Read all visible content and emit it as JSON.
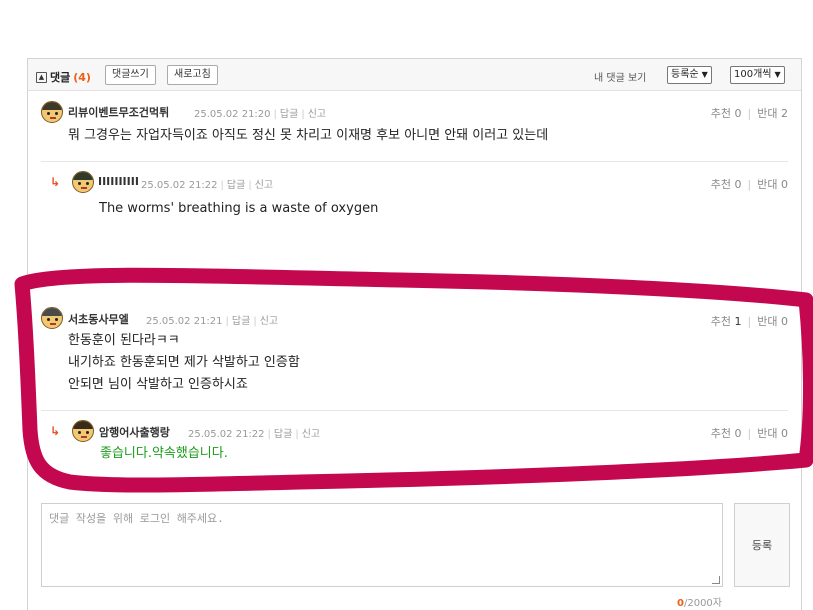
{
  "header": {
    "title": "댓글",
    "count": "(4)",
    "write_button": "댓글쓰기",
    "refresh_button": "새로고침",
    "my_comments": "내 댓글 보기",
    "sort_select": "등록순",
    "page_size_select": "100개씩"
  },
  "comments": [
    {
      "nick": "리뷰이벤트무조건먹튀",
      "date": "25.05.02 21:20",
      "reply": "답글",
      "report": "신고",
      "recommend_label": "추천",
      "recommend": "0",
      "oppose_label": "반대",
      "oppose": "2",
      "lines": [
        "뭐 그경우는 자업자득이죠 아직도 정신 못 차리고 이재명 후보 아니면 안돼 이러고 있는데"
      ]
    },
    {
      "nick": "IIIIIIIIII",
      "date": "25.05.02 21:22",
      "reply": "답글",
      "report": "신고",
      "recommend_label": "추천",
      "recommend": "0",
      "oppose_label": "반대",
      "oppose": "0",
      "lines": [
        "The worms' breathing is a waste of oxygen"
      ]
    },
    {
      "nick": "서초동사무엘",
      "date": "25.05.02 21:21",
      "reply": "답글",
      "report": "신고",
      "recommend_label": "추천",
      "recommend": "1",
      "oppose_label": "반대",
      "oppose": "0",
      "lines": [
        "한동훈이 된다라ㅋㅋ",
        "내기하죠 한동훈되면 제가 삭발하고 인증함",
        "안되면 님이 삭발하고 인증하시죠"
      ]
    },
    {
      "nick": "암행어사출행랑",
      "date": "25.05.02 21:22",
      "reply": "답글",
      "report": "신고",
      "recommend_label": "추천",
      "recommend": "0",
      "oppose_label": "반대",
      "oppose": "0",
      "lines": [
        "좋습니다.약속했습니다."
      ]
    }
  ],
  "reply_marker": "↳",
  "write": {
    "placeholder": "댓글 작성을 위해 로그인 해주세요.",
    "submit": "등록",
    "count_current": "0",
    "count_max": "/2000자"
  },
  "colors": {
    "highlight": "#c4084f",
    "accent": "#ec5f17",
    "reply_text": "#1a9c1a"
  }
}
